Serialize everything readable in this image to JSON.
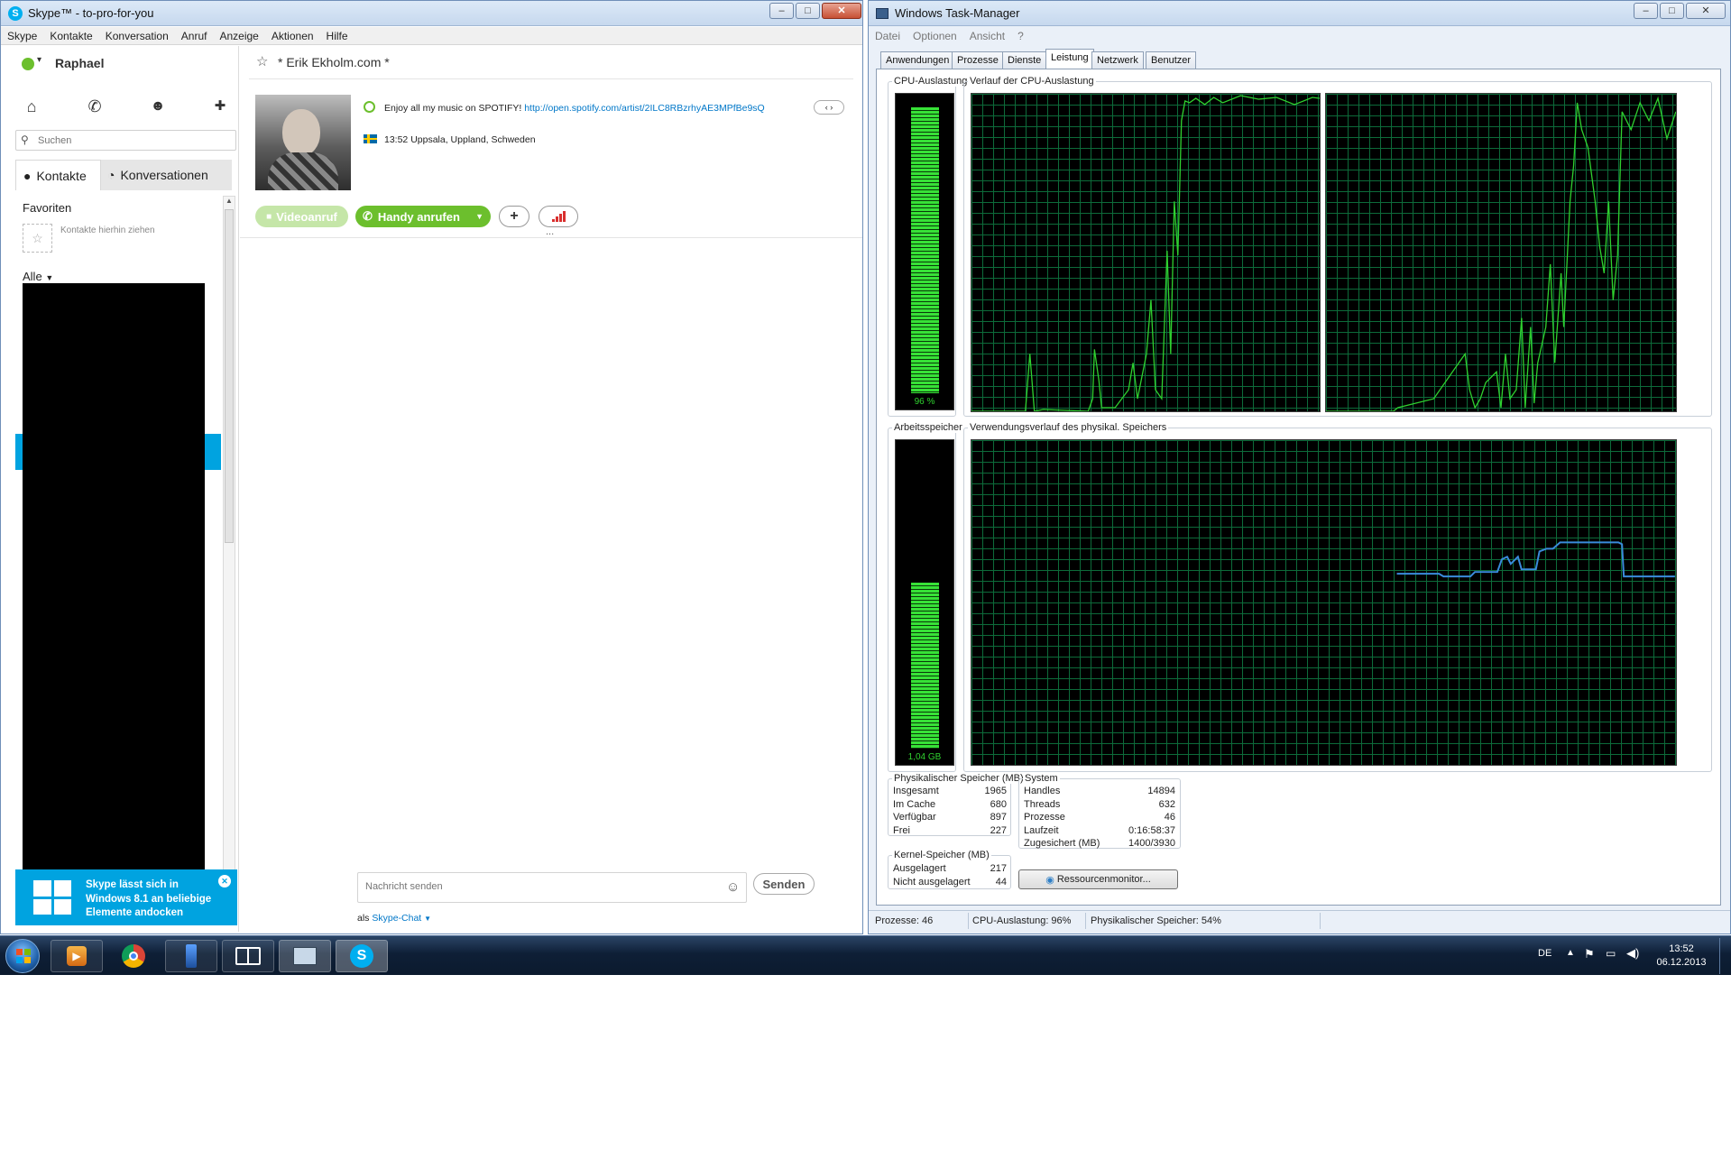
{
  "skype": {
    "title": "Skype™ - to-pro-for-you",
    "menu": [
      "Skype",
      "Kontakte",
      "Konversation",
      "Anruf",
      "Anzeige",
      "Aktionen",
      "Hilfe"
    ],
    "user_name": "Raphael",
    "search_placeholder": "Suchen",
    "tabs": {
      "contacts": "Kontakte",
      "conversations": "Konversationen"
    },
    "favorites_label": "Favoriten",
    "favorites_hint": "Kontakte hierhin ziehen",
    "all_label": "Alle",
    "banner_text": "Skype lässt sich in Windows 8.1 an beliebige Elemente andocken",
    "chat": {
      "contact_name": "* Erik Ekholm.com *",
      "mood_text": "Enjoy all my music on SPOTIFY!",
      "mood_link": "http://open.spotify.com/artist/2ILC8RBzrhyAE3MPfBe9sQ",
      "location": "13:52 Uppsala, Uppland, Schweden",
      "video_button": "Videoanruf",
      "call_button": "Handy anrufen",
      "more_dots": "...",
      "message_placeholder": "Nachricht senden",
      "send_button": "Senden",
      "as_label": "als",
      "as_value": "Skype-Chat"
    }
  },
  "taskmanager": {
    "title": "Windows Task-Manager",
    "menu": [
      "Datei",
      "Optionen",
      "Ansicht",
      "?"
    ],
    "tabs": [
      "Anwendungen",
      "Prozesse",
      "Dienste",
      "Leistung",
      "Netzwerk",
      "Benutzer"
    ],
    "active_tab": "Leistung",
    "cpu_label": "CPU-Auslastung",
    "cpu_value": "96 %",
    "cpu_fraction": 0.96,
    "cpu_history_label": "Verlauf der CPU-Auslastung",
    "mem_label": "Arbeitsspeicher",
    "mem_value": "1,04 GB",
    "mem_fraction": 0.54,
    "mem_history_label": "Verwendungsverlauf des physikal. Speichers",
    "physical": {
      "title": "Physikalischer Speicher (MB)",
      "rows": [
        [
          "Insgesamt",
          "1965"
        ],
        [
          "Im Cache",
          "680"
        ],
        [
          "Verfügbar",
          "897"
        ],
        [
          "Frei",
          "227"
        ]
      ]
    },
    "kernel": {
      "title": "Kernel-Speicher (MB)",
      "rows": [
        [
          "Ausgelagert",
          "217"
        ],
        [
          "Nicht ausgelagert",
          "44"
        ]
      ]
    },
    "system": {
      "title": "System",
      "rows": [
        [
          "Handles",
          "14894"
        ],
        [
          "Threads",
          "632"
        ],
        [
          "Prozesse",
          "46"
        ],
        [
          "Laufzeit",
          "0:16:58:37"
        ],
        [
          "Zugesichert (MB)",
          "1400/3930"
        ]
      ]
    },
    "resource_button": "Ressourcenmonitor...",
    "status": {
      "processes": "Prozesse: 46",
      "cpu": "CPU-Auslastung: 96%",
      "memory": "Physikalischer Speicher: 54%"
    }
  },
  "taskbar": {
    "language": "DE",
    "time": "13:52",
    "date": "06.12.2013"
  }
}
